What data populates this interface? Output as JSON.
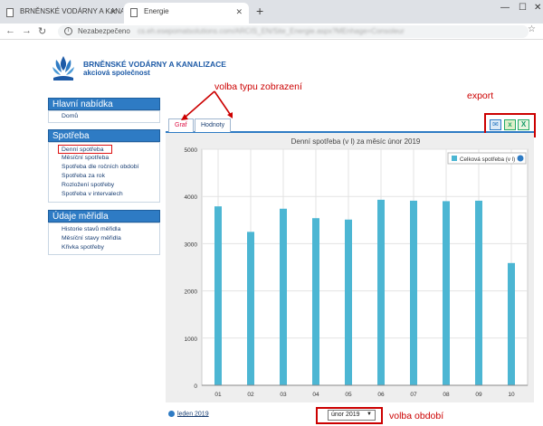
{
  "browser": {
    "tabs": [
      {
        "label": "BRNĚNSKÉ VODÁRNY A KANALIZ..."
      },
      {
        "label": "Energie"
      }
    ],
    "security_label": "Nezabezpečeno",
    "url": "cs.eh.esepomatsolutions.com/ARCIS_EN/Site_Energie.aspx?MEnhage=Consoleur"
  },
  "logo": {
    "line1": "BRNĚNSKÉ VODÁRNY A KANALIZACE",
    "line2": "akciová společnost"
  },
  "menus": [
    {
      "title": "Hlavní nabídka",
      "items": [
        "Domů"
      ]
    },
    {
      "title": "Spotřeba",
      "items": [
        "Denní spotřeba",
        "Měsíční spotřeba",
        "Spotřeba dle ročních období",
        "Spotřeba za rok",
        "Rozložení spotřeby",
        "Spotřeba v intervalech"
      ]
    },
    {
      "title": "Údaje měřidla",
      "items": [
        "Historie stavů měřidla",
        "Měsíční stavy měřidla",
        "Křivka spotřeby"
      ]
    }
  ],
  "content_tabs": [
    "Graf",
    "Hodnoty"
  ],
  "export_icons": [
    "email-icon",
    "excel-icon",
    "excel-x-icon"
  ],
  "annotations": {
    "view_type": "volba typu zobrazení",
    "export": "export",
    "period": "volba období"
  },
  "chart_data": {
    "type": "bar",
    "title": "Denní spotřeba (v l) za měsíc únor 2019",
    "categories": [
      "01",
      "02",
      "03",
      "04",
      "05",
      "06",
      "07",
      "08",
      "09",
      "10"
    ],
    "series": [
      {
        "name": "Celková spotřeba (v l)",
        "values": [
          3790,
          3250,
          3740,
          3540,
          3510,
          3930,
          3910,
          3900,
          3910,
          2590
        ],
        "color": "#4cb6d3"
      }
    ],
    "ylim": [
      0,
      5000
    ],
    "yticks": [
      "0",
      "1000",
      "2000",
      "3000",
      "4000",
      "5000"
    ],
    "legend": "top-right",
    "grid": true
  },
  "footer": {
    "prev_link": "leden 2019",
    "period_value": "únor 2019"
  }
}
